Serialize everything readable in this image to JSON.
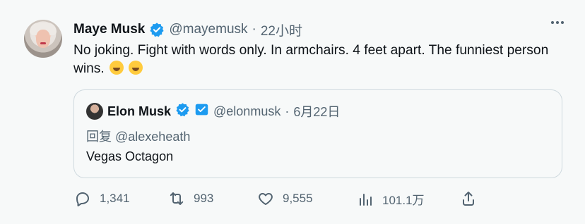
{
  "tweet": {
    "author": {
      "name": "Maye Musk",
      "handle": "@mayemusk",
      "time": "22小时"
    },
    "text": "No joking. Fight with words only. In armchairs. 4 feet apart.  The funniest person wins."
  },
  "quote": {
    "name": "Elon Musk",
    "handle": "@elonmusk",
    "time": "6月22日",
    "reply_to": "回复 @alexeheath",
    "text": "Vegas Octagon"
  },
  "actions": {
    "reply_count": "1,341",
    "retweet_count": "993",
    "like_count": "9,555",
    "views_count": "101.1万"
  },
  "icons": {
    "verified": "verified-badge-icon",
    "more": "more-icon",
    "reply": "reply-icon",
    "retweet": "retweet-icon",
    "like": "heart-icon",
    "views": "views-icon",
    "share": "share-icon"
  },
  "colors": {
    "background": "#f7f9f9",
    "text": "#0f1419",
    "secondary_text": "#536471",
    "border": "#cfd9de",
    "verified_blue": "#1d9bf0"
  }
}
